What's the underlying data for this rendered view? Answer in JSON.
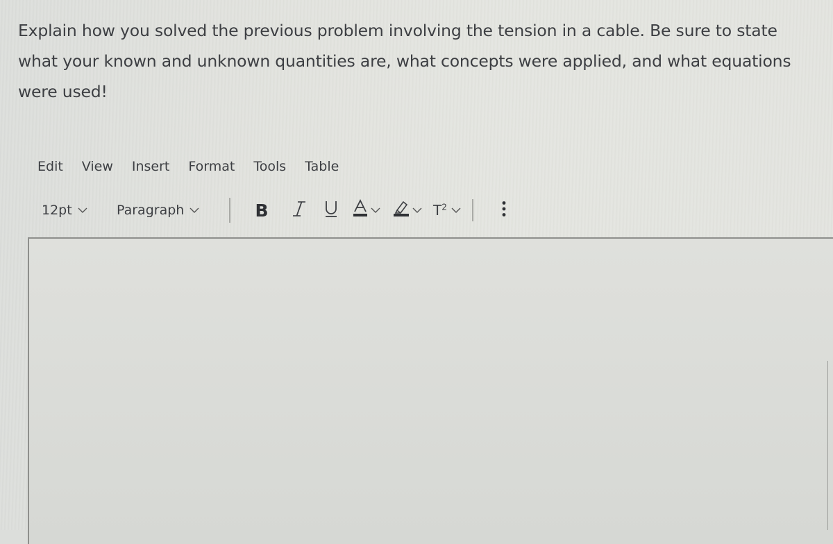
{
  "prompt": {
    "line1": "Explain how you solved the previous problem involving the tension in a cable. Be sure to state",
    "line2": "what your known and unknown quantities are, what concepts were applied, and what equations",
    "line3": "were used!"
  },
  "menubar": {
    "items": [
      "Edit",
      "View",
      "Insert",
      "Format",
      "Tools",
      "Table"
    ]
  },
  "toolbar": {
    "font_size": "12pt",
    "block_format": "Paragraph",
    "bold_label": "B",
    "italic_label": "I",
    "underline_label": "U",
    "text_color_label": "A",
    "superscript_label": "T",
    "superscript_exp": "2",
    "more_label": "⋮",
    "icons": {
      "bold": "bold-icon",
      "italic": "italic-icon",
      "underline": "underline-icon",
      "text_color": "text-color-icon",
      "highlight": "highlighter-icon",
      "superscript": "superscript-icon",
      "more": "more-vertical-icon"
    }
  },
  "editor": {
    "content": ""
  },
  "colors": {
    "text": "#3d3f43",
    "background": "#e2e3de",
    "border": "#8e8f8c"
  }
}
